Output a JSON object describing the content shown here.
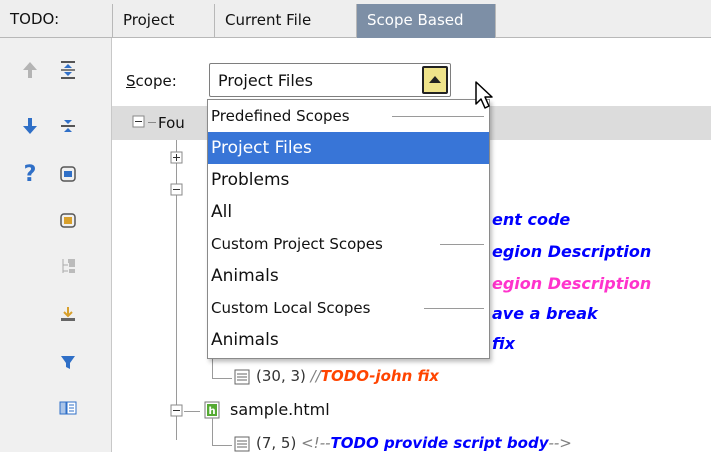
{
  "todo_label": "TODO:",
  "tabs": [
    {
      "label": "Project"
    },
    {
      "label": "Current File"
    },
    {
      "label": "Scope Based"
    }
  ],
  "scope": {
    "label": "Scope:",
    "value": "Project Files"
  },
  "tree": {
    "root_label": "Fou",
    "file_label": "sample.html"
  },
  "dropdown": {
    "items": [
      {
        "label": "Predefined Scopes"
      },
      {
        "label": "Project Files"
      },
      {
        "label": "Problems"
      },
      {
        "label": "All"
      },
      {
        "label": "Custom Project Scopes"
      },
      {
        "label": "Animals"
      },
      {
        "label": "Custom Local Scopes"
      },
      {
        "label": "Animals"
      }
    ]
  },
  "behind": [
    {
      "text": "ent code"
    },
    {
      "text": "egion Description"
    },
    {
      "text": "egion Description"
    },
    {
      "text": "ave a break"
    },
    {
      "text": "fix"
    }
  ],
  "todos": [
    {
      "coords": "(30, 3)",
      "prefix": "//",
      "todo": "TODO-john fix",
      "suffix": ""
    },
    {
      "coords": "(7, 5)",
      "prefix": "<!--",
      "todo": "TODO provide script body",
      "suffix": "-->"
    }
  ],
  "colors": {
    "accent_blue": "#3875d7",
    "tab_active": "#7d8fa6",
    "todo_blue": "#0000ff",
    "todo_magenta": "#ff33cc",
    "todo_orange": "#ff4400"
  }
}
